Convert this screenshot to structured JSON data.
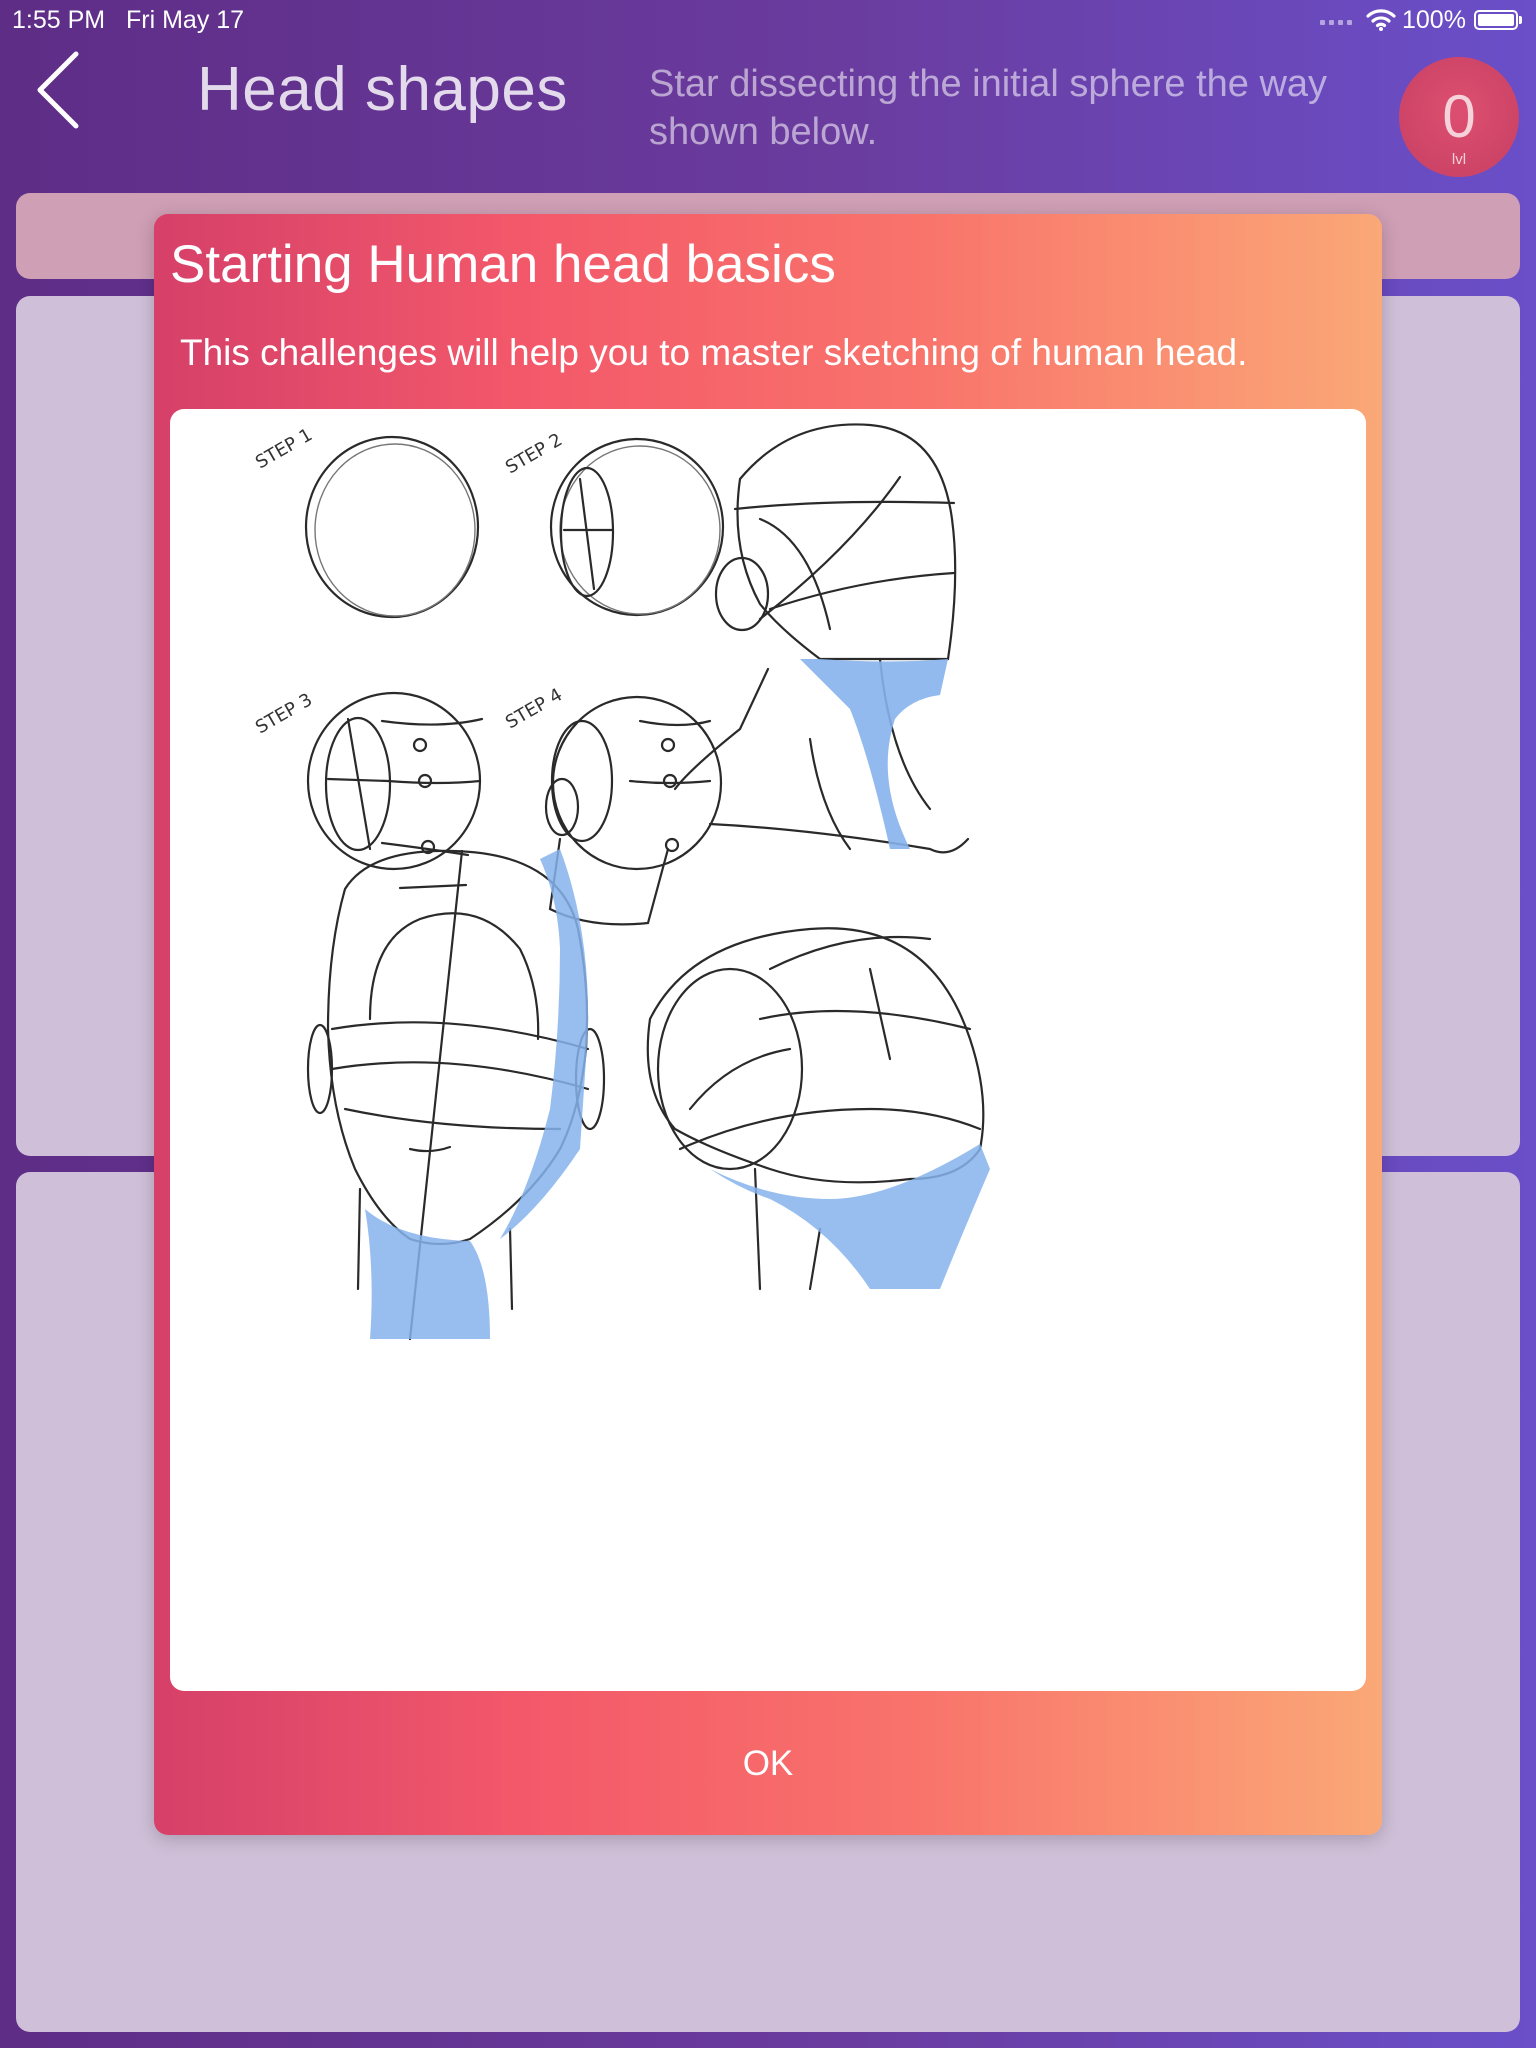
{
  "status_bar": {
    "time": "1:55 PM",
    "date": "Fri May 17",
    "battery": "100%"
  },
  "header": {
    "title": "Head shapes",
    "subtitle": "Star dissecting the initial sphere the way shown below.",
    "level_value": "0",
    "level_label": "lvl"
  },
  "modal": {
    "title": "Starting Human head basics",
    "description": "This challenges will help you to master sketching of human head.",
    "ok_label": "OK",
    "image": {
      "step_labels": [
        "STEP 1",
        "STEP 2",
        "STEP 3",
        "STEP 4"
      ],
      "accent_color": "#86b3ec"
    }
  },
  "colors": {
    "background_start": "#5e2d86",
    "background_end": "#6a4fc9",
    "modal_gradient_start": "#d64069",
    "modal_gradient_end": "#faa877",
    "level_badge": "#d14869",
    "card": "#cfbfd8"
  }
}
